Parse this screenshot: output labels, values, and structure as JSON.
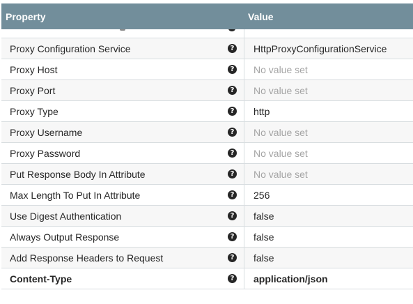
{
  "header": {
    "property_label": "Property",
    "value_label": "Value"
  },
  "rows": [
    {
      "property": "Proxy Configuration Service",
      "value": "HttpProxyConfigurationService",
      "unset": false
    },
    {
      "property": "Proxy Host",
      "value": "No value set",
      "unset": true
    },
    {
      "property": "Proxy Port",
      "value": "No value set",
      "unset": true
    },
    {
      "property": "Proxy Type",
      "value": "http",
      "unset": false
    },
    {
      "property": "Proxy Username",
      "value": "No value set",
      "unset": true
    },
    {
      "property": "Proxy Password",
      "value": "No value set",
      "unset": true
    },
    {
      "property": "Put Response Body In Attribute",
      "value": "No value set",
      "unset": true
    },
    {
      "property": "Max Length To Put In Attribute",
      "value": "256",
      "unset": false
    },
    {
      "property": "Use Digest Authentication",
      "value": "false",
      "unset": false
    },
    {
      "property": "Always Output Response",
      "value": "false",
      "unset": false
    },
    {
      "property": "Add Response Headers to Request",
      "value": "false",
      "unset": false
    },
    {
      "property": "Content-Type",
      "value": "application/json",
      "unset": false,
      "bold": true
    }
  ],
  "icons": {
    "help": "question-circle-icon"
  },
  "colors": {
    "header_bg": "#728e9b",
    "unset_text": "#a4a4a4"
  }
}
